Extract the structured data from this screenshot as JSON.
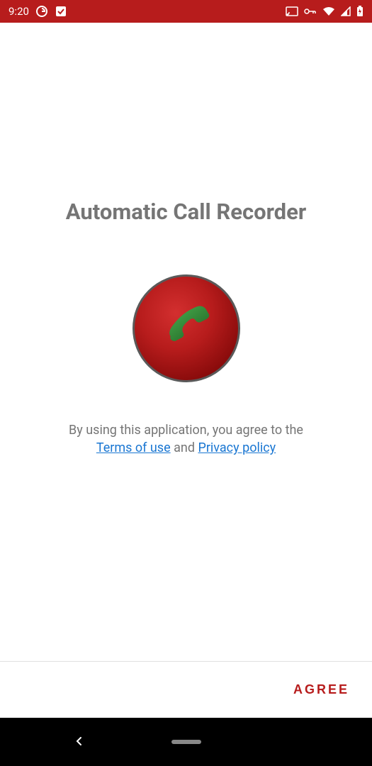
{
  "statusBar": {
    "time": "9:20",
    "gIcon": "G",
    "boxIcon": "□"
  },
  "main": {
    "title": "Automatic Call Recorder",
    "termsIntro": "By using this application, you agree to the",
    "termsOfUse": "Terms of use",
    "and": " and ",
    "privacyPolicy": "Privacy policy"
  },
  "footer": {
    "agreeButton": "AGREE"
  }
}
